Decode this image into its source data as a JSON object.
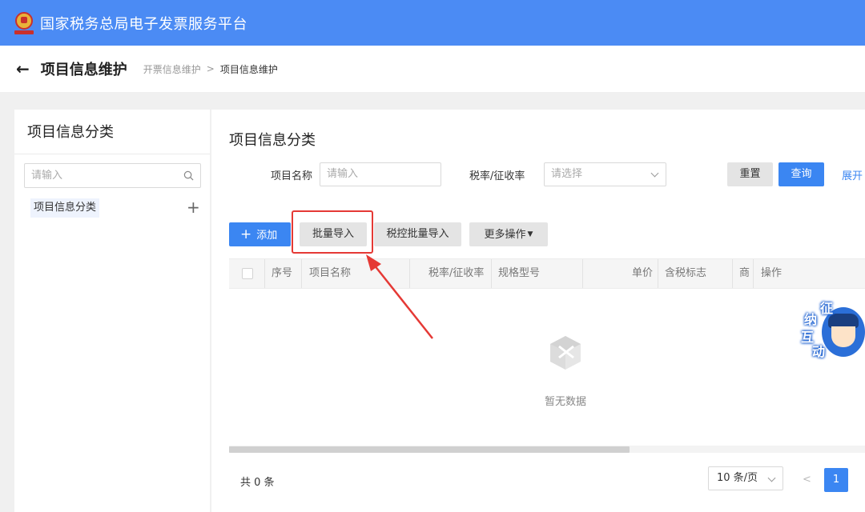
{
  "topbar": {
    "title": "国家税务总局电子发票服务平台"
  },
  "subheader": {
    "page_title": "项目信息维护",
    "breadcrumb_parent": "开票信息维护",
    "breadcrumb_separator": ">",
    "breadcrumb_current": "项目信息维护"
  },
  "sidebar": {
    "title": "项目信息分类",
    "search_placeholder": "请输入",
    "tree_items": [
      {
        "label": "项目信息分类"
      }
    ]
  },
  "main": {
    "title": "项目信息分类",
    "filters": {
      "name_label": "项目名称",
      "name_placeholder": "请输入",
      "rate_label": "税率/征收率",
      "rate_placeholder": "请选择"
    },
    "actions": {
      "reset": "重置",
      "query": "查询",
      "expand": "展开"
    },
    "toolbar": {
      "add": "添加",
      "batch_import": "批量导入",
      "tax_batch_import": "税控批量导入",
      "more": "更多操作"
    },
    "table": {
      "columns": [
        "序号",
        "项目名称",
        "税率/征收率",
        "规格型号",
        "单价",
        "含税标志",
        "商品",
        "操作"
      ],
      "rows": [],
      "empty_text": "暂无数据"
    },
    "pagination": {
      "total_text": "共 0 条",
      "page_size": "10 条/页",
      "prev": "<",
      "current_page": "1"
    }
  },
  "widget": {
    "chars": [
      "征",
      "纳",
      "互",
      "动"
    ]
  },
  "colors": {
    "topbar": "#4b8bf4",
    "primary": "#3b86f2",
    "highlight": "#e53935"
  }
}
